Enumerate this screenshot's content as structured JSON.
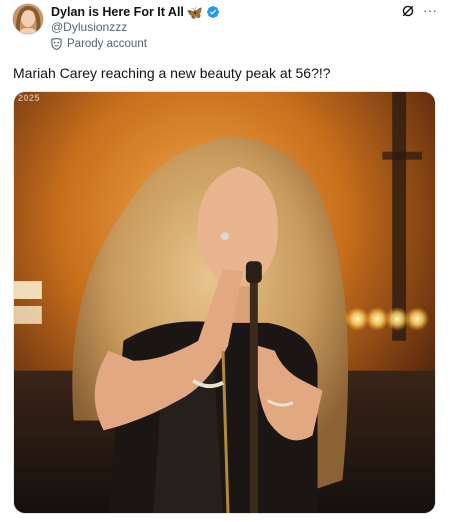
{
  "author": {
    "display_name": "Dylan is Here For It All",
    "display_name_emoji": "🦋",
    "handle": "@Dylusionzzz",
    "label": "Parody account",
    "verified": true,
    "verified_color": "#1d9bf0"
  },
  "actions": {
    "grok_icon": "grok-icon",
    "more_icon": "more-icon",
    "more_label": "···"
  },
  "tweet": {
    "text": "Mariah Carey reaching a new beauty peak at 56?!?"
  },
  "media": {
    "description_icon": "photo",
    "watermark": "2025"
  }
}
